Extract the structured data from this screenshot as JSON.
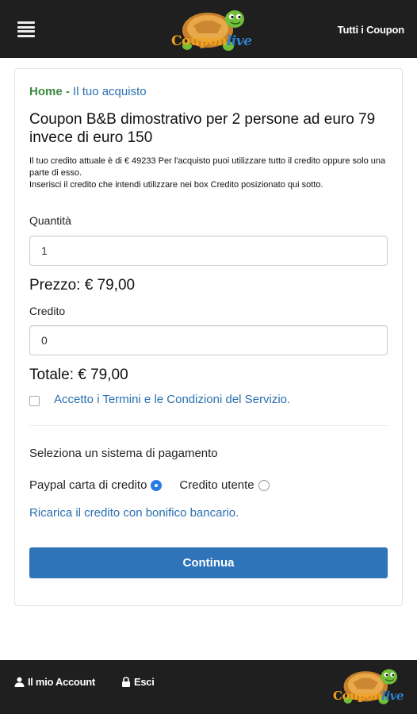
{
  "header": {
    "logo_text_part1": "Coupon",
    "logo_text_part2": "live",
    "all_coupons_link": "Tutti i Coupon"
  },
  "breadcrumb": {
    "home": "Home",
    "separator": " - ",
    "current": "Il tuo acquisto"
  },
  "product": {
    "title": "Coupon B&B dimostrativo per 2 persone ad euro 79 invece di euro 150"
  },
  "info": {
    "line1": "Il tuo credito attuale è di € 49233 Per l'acquisto puoi utilizzare tutto il credito oppure solo una parte di esso.",
    "line2": "Inserisci il credito che intendi utilizzare nei box Credito posizionato qui sotto."
  },
  "form": {
    "quantity_label": "Quantità",
    "quantity_value": "1",
    "price_text": "Prezzo: € 79,00",
    "credit_label": "Credito",
    "credit_value": "0",
    "total_text": "Totale: € 79,00",
    "terms_text": "Accetto i Termini e le Condizioni del Servizio.",
    "terms_checked": false
  },
  "payment": {
    "heading": "Seleziona un sistema di pagamento",
    "options": [
      {
        "label": "Paypal carta di credito",
        "selected": true
      },
      {
        "label": "Credito utente",
        "selected": false
      }
    ],
    "recharge_link": "Ricarica il credito con bonifico bancario.",
    "continue_label": "Continua"
  },
  "footer": {
    "account_link": "Il mio Account",
    "logout_link": "Esci",
    "logo_text_part1": "Coupon",
    "logo_text_part2": "live"
  },
  "colors": {
    "bar_background": "#1f1f1f",
    "link_blue": "#2a6fb0",
    "home_green": "#3a8a3e",
    "button_blue": "#2f74b8",
    "radio_selected": "#2a7be4"
  }
}
